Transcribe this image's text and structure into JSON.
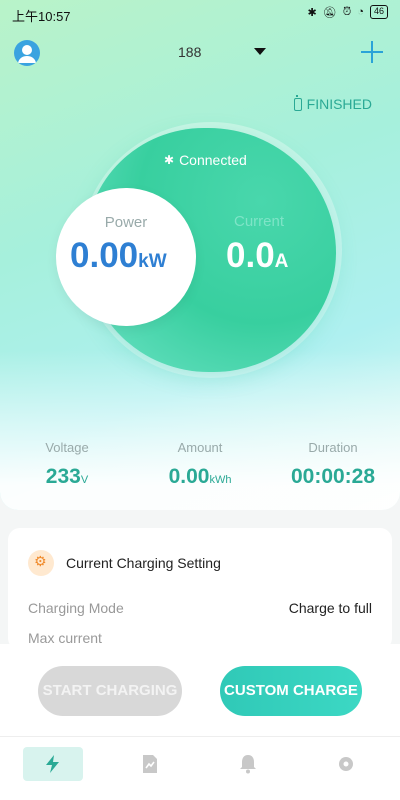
{
  "status_bar": {
    "time": "上午10:57",
    "icons": [
      "bluetooth-icon",
      "mute-icon",
      "alarm-icon",
      "wifi-icon"
    ],
    "battery": "46"
  },
  "header": {
    "device": "188",
    "add_icon": "plus-icon"
  },
  "state": {
    "status": "FINISHED",
    "connection": "Connected"
  },
  "power": {
    "label": "Power",
    "value": "0.00",
    "unit": "kW"
  },
  "current": {
    "label": "Current",
    "value": "0.0",
    "unit": "A"
  },
  "stats": {
    "voltage": {
      "label": "Voltage",
      "value": "233",
      "unit": "V"
    },
    "amount": {
      "label": "Amount",
      "value": "0.00",
      "unit": "kWh"
    },
    "duration": {
      "label": "Duration",
      "value": "00:00:28"
    }
  },
  "settings": {
    "title": "Current Charging Setting",
    "mode_label": "Charging Mode",
    "mode_value": "Charge to full",
    "max_current_label": "Max current"
  },
  "actions": {
    "start": "START CHARGING",
    "custom": "CUSTOM CHARGE"
  },
  "nav": {
    "items": [
      "charge-icon",
      "records-icon",
      "notifications-icon",
      "settings-icon"
    ],
    "active": 0
  },
  "colors": {
    "accent": "#2aa995",
    "power_blue": "#2e7fd3",
    "plus_blue": "#2aa3d8",
    "button_teal": "#30c9b7"
  }
}
